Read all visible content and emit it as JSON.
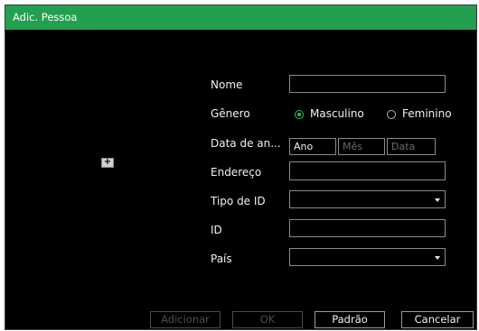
{
  "dialog": {
    "title": "Adic. Pessoa",
    "add_photo_icon": "plus-icon"
  },
  "form": {
    "name_label": "Nome",
    "name_value": "",
    "gender_label": "Gênero",
    "gender_options": [
      "Masculino",
      "Feminino"
    ],
    "gender_selected": "Masculino",
    "birthdate_label": "Data de an...",
    "birthdate_year": "Ano",
    "birthdate_month_placeholder": "Mês",
    "birthdate_day_placeholder": "Data",
    "address_label": "Endereço",
    "address_value": "",
    "id_type_label": "Tipo de ID",
    "id_type_value": "",
    "id_label": "ID",
    "id_value": "",
    "country_label": "País",
    "country_value": ""
  },
  "buttons": {
    "add": "Adicionar",
    "ok": "OK",
    "default": "Padrão",
    "cancel": "Cancelar"
  },
  "colors": {
    "titlebar": "#22a04f",
    "background": "#000000",
    "radio_selected": "#22c25a"
  }
}
